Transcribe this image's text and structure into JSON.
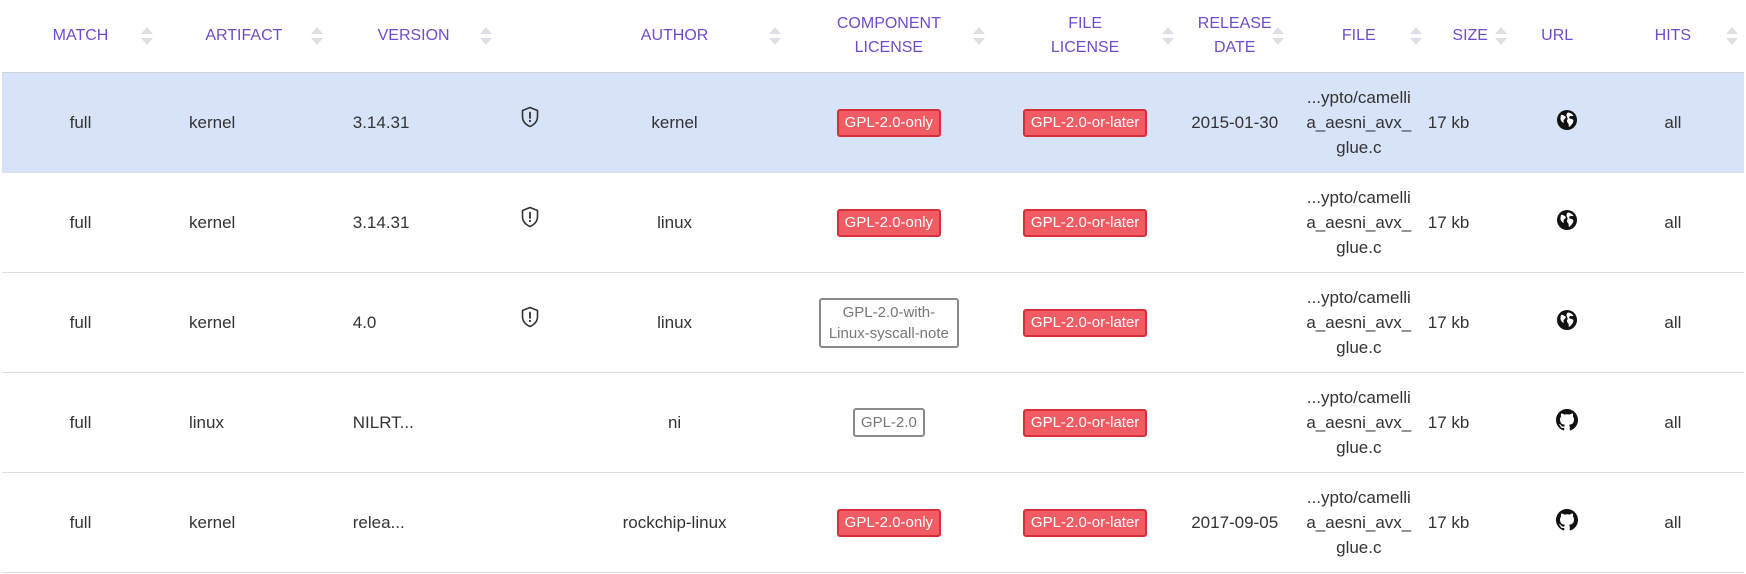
{
  "header": {
    "columns": [
      {
        "key": "match",
        "lines": [
          "MATCH"
        ],
        "sortable": true
      },
      {
        "key": "artifact",
        "lines": [
          "ARTIFACT"
        ],
        "sortable": true
      },
      {
        "key": "version",
        "lines": [
          "VERSION"
        ],
        "sortable": true
      },
      {
        "key": "vuln",
        "lines": [
          ""
        ],
        "sortable": false
      },
      {
        "key": "author",
        "lines": [
          "AUTHOR"
        ],
        "sortable": true
      },
      {
        "key": "component_license",
        "lines": [
          "COMPONENT",
          "LICENSE"
        ],
        "sortable": true
      },
      {
        "key": "file_license",
        "lines": [
          "FILE",
          "LICENSE"
        ],
        "sortable": true
      },
      {
        "key": "release_date",
        "lines": [
          "RELEASE",
          "DATE"
        ],
        "sortable": true
      },
      {
        "key": "file",
        "lines": [
          "FILE"
        ],
        "sortable": true
      },
      {
        "key": "size",
        "lines": [
          "SIZE"
        ],
        "sortable": true
      },
      {
        "key": "url",
        "lines": [
          "URL"
        ],
        "sortable": false
      },
      {
        "key": "hits",
        "lines": [
          "HITS"
        ],
        "sortable": true
      }
    ]
  },
  "rows": [
    {
      "selected": true,
      "match": "full",
      "artifact": "kernel",
      "version": "3.14.31",
      "has_vuln_icon": true,
      "author": "kernel",
      "component_license": {
        "text": "GPL-2.0-only",
        "style": "red"
      },
      "file_license": {
        "text": "GPL-2.0-or-later",
        "style": "red"
      },
      "release_date": "2015-01-30",
      "file": "...ypto/camellia_aesni_avx_glue.c",
      "size": "17 kb",
      "url_icon": "globe-icon",
      "hits": "all"
    },
    {
      "selected": false,
      "match": "full",
      "artifact": "kernel",
      "version": "3.14.31",
      "has_vuln_icon": true,
      "author": "linux",
      "component_license": {
        "text": "GPL-2.0-only",
        "style": "red"
      },
      "file_license": {
        "text": "GPL-2.0-or-later",
        "style": "red"
      },
      "release_date": "",
      "file": "...ypto/camellia_aesni_avx_glue.c",
      "size": "17 kb",
      "url_icon": "globe-icon",
      "hits": "all"
    },
    {
      "selected": false,
      "match": "full",
      "artifact": "kernel",
      "version": "4.0",
      "has_vuln_icon": true,
      "author": "linux",
      "component_license": {
        "text": "GPL-2.0-with-Linux-syscall-note",
        "style": "outline"
      },
      "file_license": {
        "text": "GPL-2.0-or-later",
        "style": "red"
      },
      "release_date": "",
      "file": "...ypto/camellia_aesni_avx_glue.c",
      "size": "17 kb",
      "url_icon": "globe-icon",
      "hits": "all"
    },
    {
      "selected": false,
      "match": "full",
      "artifact": "linux",
      "version": "NILRT...",
      "has_vuln_icon": false,
      "author": "ni",
      "component_license": {
        "text": "GPL-2.0",
        "style": "outline"
      },
      "file_license": {
        "text": "GPL-2.0-or-later",
        "style": "red"
      },
      "release_date": "",
      "file": "...ypto/camellia_aesni_avx_glue.c",
      "size": "17 kb",
      "url_icon": "github-icon",
      "hits": "all"
    },
    {
      "selected": false,
      "match": "full",
      "artifact": "kernel",
      "version": "relea...",
      "has_vuln_icon": false,
      "author": "rockchip-linux",
      "component_license": {
        "text": "GPL-2.0-only",
        "style": "red"
      },
      "file_license": {
        "text": "GPL-2.0-or-later",
        "style": "red"
      },
      "release_date": "2017-09-05",
      "file": "...ypto/camellia_aesni_avx_glue.c",
      "size": "17 kb",
      "url_icon": "github-icon",
      "hits": "all"
    }
  ],
  "colors": {
    "header_text": "#6f4cc9",
    "selected_row": "#d7e3f8",
    "license_red": "#f15b63",
    "license_red_border": "#d62f3a"
  }
}
